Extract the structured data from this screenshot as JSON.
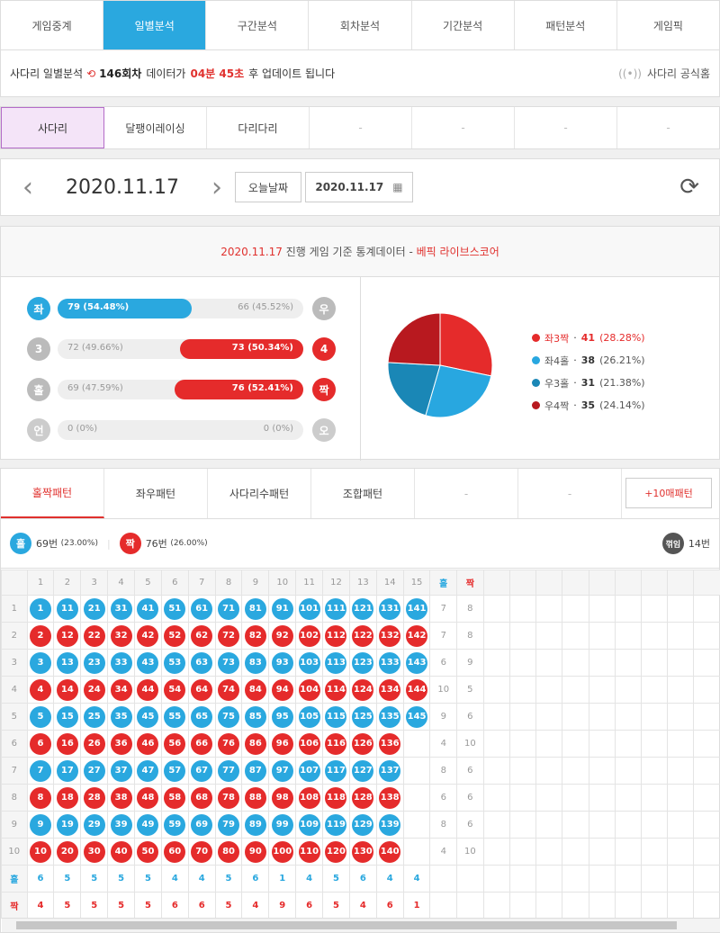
{
  "tabs": [
    "게임중계",
    "일별분석",
    "구간분석",
    "회차분석",
    "기간분석",
    "패턴분석",
    "게임픽"
  ],
  "info": {
    "game": "사다리 일별분석",
    "round": "146회차",
    "mid": "데이터가",
    "time": "04분 45초",
    "tail": "후 업데이트 됩니다",
    "official": "사다리 공식홈"
  },
  "subtabs": [
    "사다리",
    "달팽이레이싱",
    "다리다리",
    "-",
    "-",
    "-",
    "-"
  ],
  "datebar": {
    "date": "2020.11.17",
    "today": "오늘날짜",
    "input": "2020.11.17",
    "prev": "‹",
    "next": "›"
  },
  "stats": {
    "date": "2020.11.17",
    "title": "진행 게임 기준 통계데이터 -",
    "brand": "베픽 라이브스코어",
    "rows": [
      {
        "l": "좌",
        "r": "우",
        "lt": "79 (54.48%)",
        "rt": "66 (45.52%)",
        "lv": 54.48,
        "win": "left",
        "color": "#2aa8df"
      },
      {
        "l": "3",
        "r": "4",
        "lt": "72 (49.66%)",
        "rt": "73 (50.34%)",
        "lv": 49.66,
        "win": "right",
        "color": "#e52b2b"
      },
      {
        "l": "홀",
        "r": "짝",
        "lt": "69 (47.59%)",
        "rt": "76 (52.41%)",
        "lv": 47.59,
        "win": "right",
        "color": "#e52b2b"
      },
      {
        "l": "언",
        "r": "오",
        "lt": "0 (0%)",
        "rt": "0 (0%)",
        "lv": 0,
        "win": "none",
        "color": "#ccc"
      }
    ]
  },
  "chart_data": {
    "type": "pie",
    "labels": [
      "좌3짝",
      "좌4홀",
      "우3홀",
      "우4짝"
    ],
    "values": [
      41,
      38,
      31,
      35
    ],
    "percent": [
      "(28.28%)",
      "(26.21%)",
      "(21.38%)",
      "(24.14%)"
    ],
    "colors": [
      "#e52b2b",
      "#28a7e0",
      "#1a87b6",
      "#b8191f"
    ]
  },
  "pattern": {
    "tabs": [
      "홀짝패턴",
      "좌우패턴",
      "사다리수패턴",
      "조합패턴",
      "-",
      "-"
    ],
    "p10": "+10매패턴",
    "odd_label": "홀",
    "odd_text": "69번",
    "odd_pct": "(23.00%)",
    "even_label": "짝",
    "even_text": "76번",
    "even_pct": "(26.00%)",
    "bend_label": "꺾임",
    "bend_text": "14번",
    "odd_row": [
      6,
      5,
      5,
      5,
      5,
      4,
      4,
      5,
      6,
      1,
      4,
      5,
      6,
      4,
      4
    ],
    "even_row": [
      4,
      5,
      5,
      5,
      5,
      6,
      6,
      5,
      4,
      9,
      6,
      5,
      4,
      6,
      1
    ],
    "row_odd": [
      7,
      7,
      6,
      10,
      9,
      4,
      8,
      6,
      8,
      4
    ],
    "row_even": [
      8,
      8,
      9,
      5,
      6,
      10,
      6,
      6,
      6,
      10
    ]
  },
  "colors": {
    "blue": "#2aa8df",
    "red": "#e52b2b"
  }
}
